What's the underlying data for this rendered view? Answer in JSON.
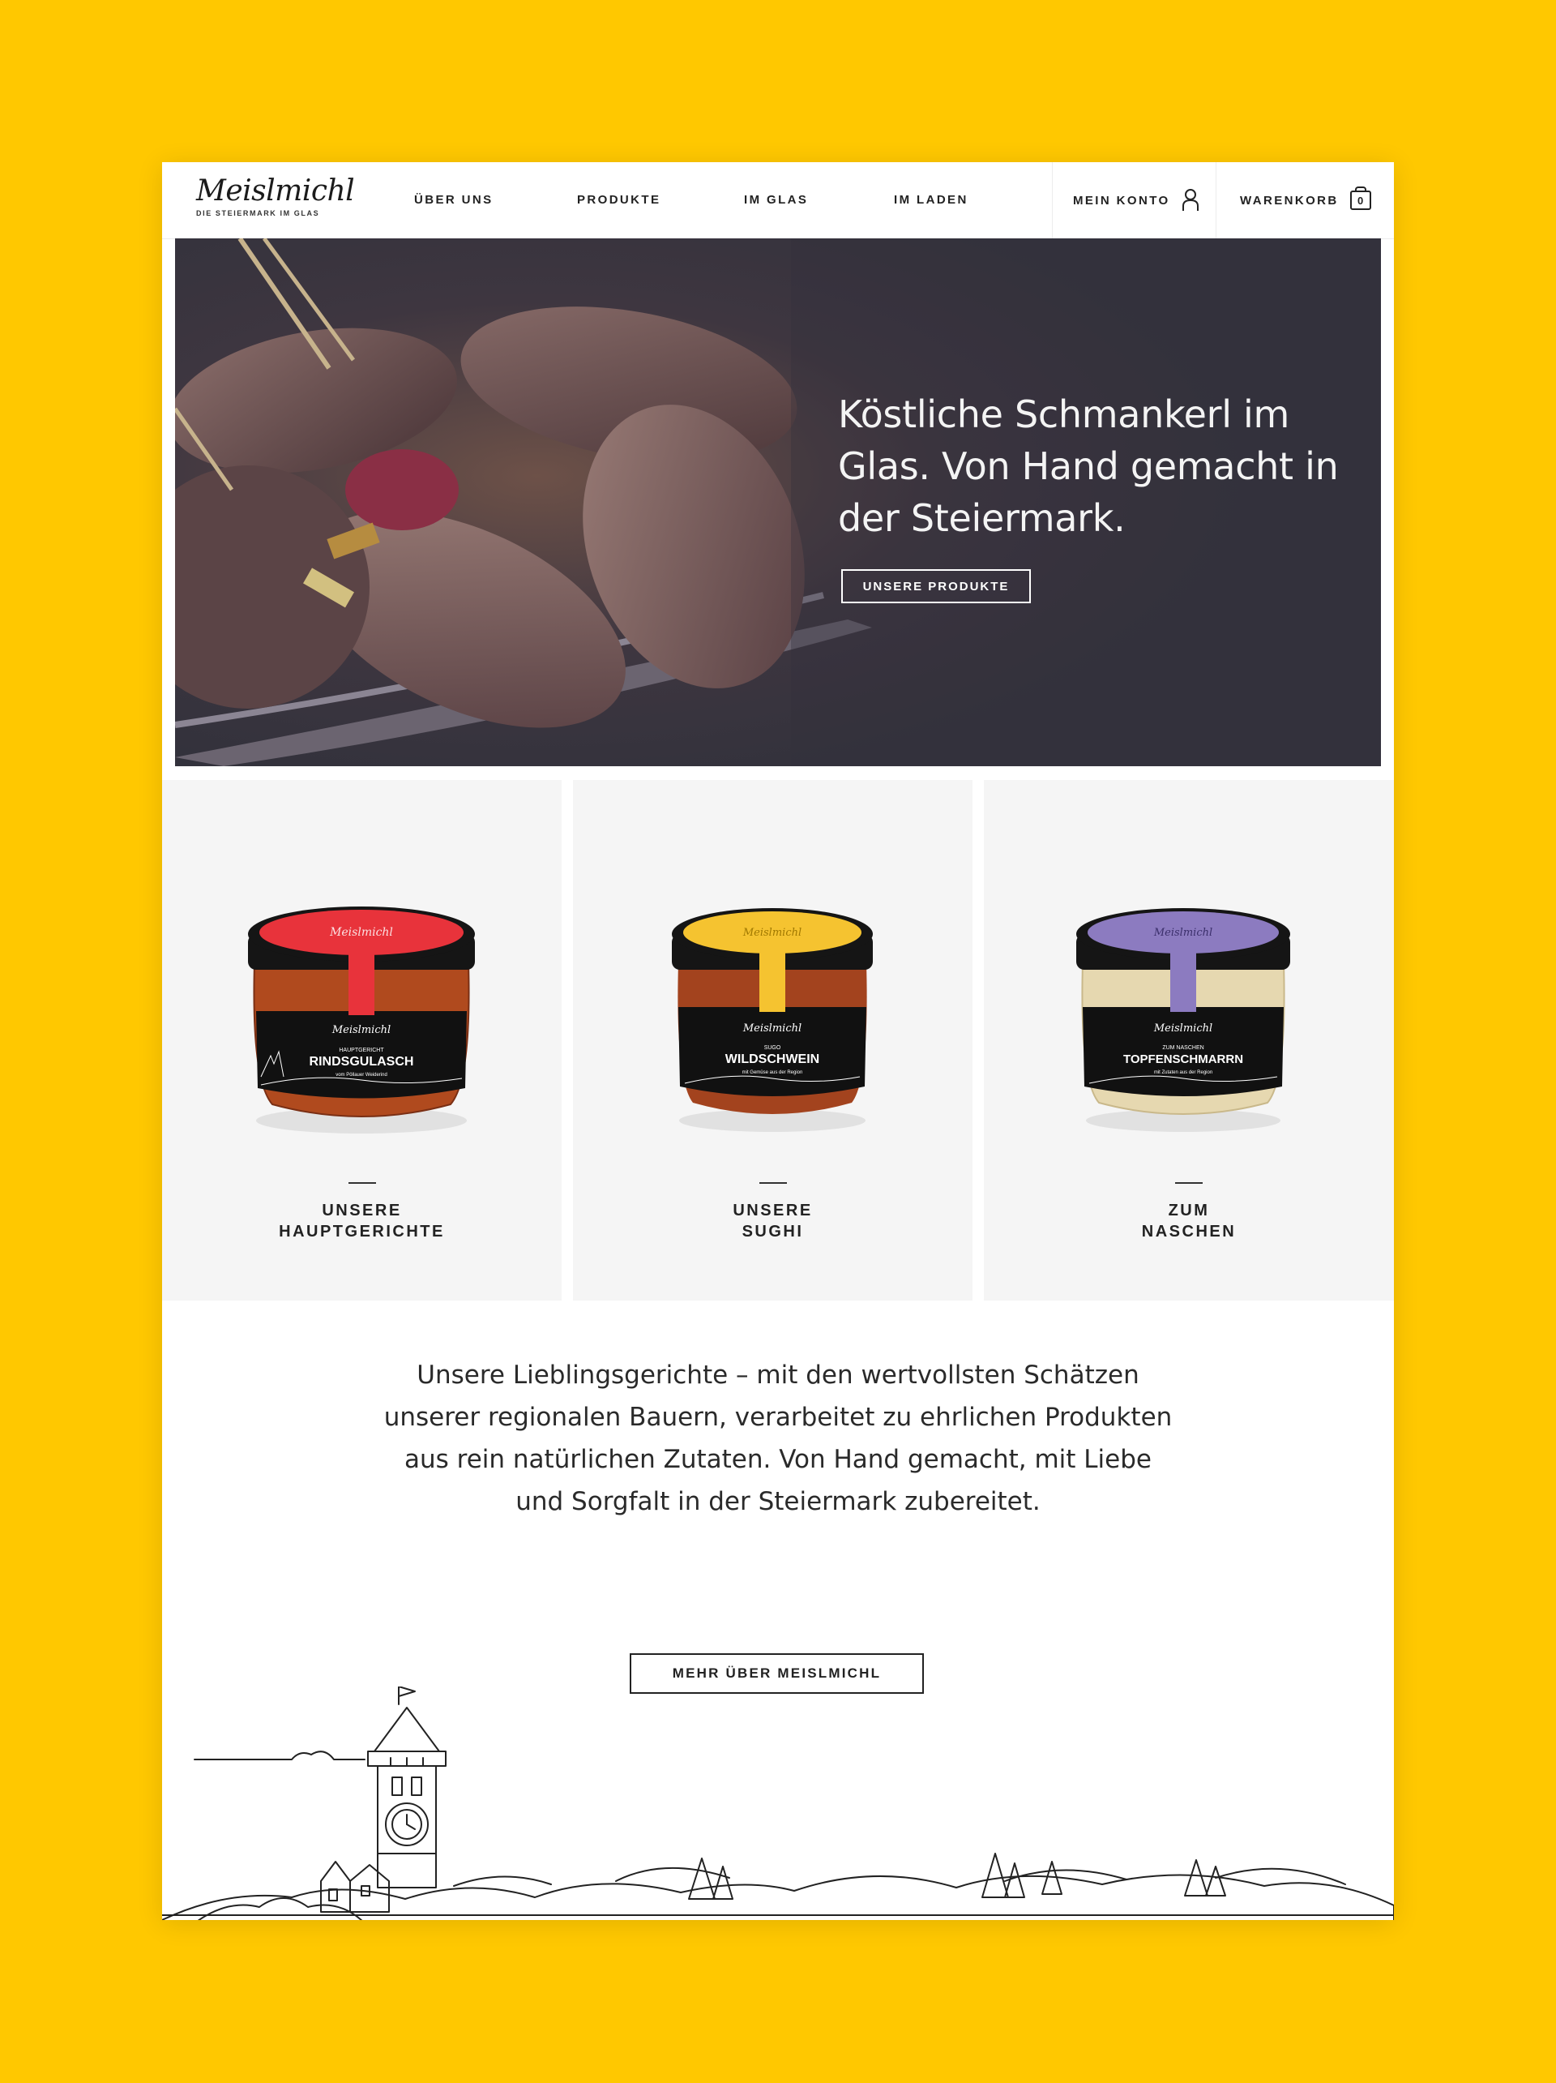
{
  "header": {
    "logo_name": "Meislmichl",
    "logo_tagline": "DIE STEIERMARK IM GLAS",
    "nav": [
      {
        "label": "ÜBER UNS"
      },
      {
        "label": "PRODUKTE"
      },
      {
        "label": "IM GLAS"
      },
      {
        "label": "IM LADEN"
      }
    ],
    "account_label": "MEIN KONTO",
    "account_icon": "user-icon",
    "cart_label": "WARENKORB",
    "cart_count": "0",
    "cart_icon": "cart-icon"
  },
  "hero": {
    "title": "Köstliche Schmankerl im Glas. Von Hand gemacht in der Steiermark.",
    "button_label": "UNSERE PRODUKTE"
  },
  "categories": [
    {
      "label_line1": "UNSERE",
      "label_line2": "HAUPTGERICHTE",
      "jar_brand": "Meislmichl",
      "jar_kicker": "HAUPTGERICHT",
      "jar_name": "RINDSGULASCH",
      "jar_sub": "vom Pöllauer Weiderind",
      "lid_color": "#E8333B",
      "fill_color": "#B04A1E"
    },
    {
      "label_line1": "UNSERE",
      "label_line2": "SUGHI",
      "jar_brand": "Meislmichl",
      "jar_kicker": "SUGO",
      "jar_name": "WILDSCHWEIN",
      "jar_sub": "mit Gemüse aus der Region",
      "lid_color": "#F5C330",
      "fill_color": "#A3431E"
    },
    {
      "label_line1": "ZUM",
      "label_line2": "NASCHEN",
      "jar_brand": "Meislmichl",
      "jar_kicker": "ZUM NASCHEN",
      "jar_name": "TOPFENSCHMARRN",
      "jar_sub": "mit Zutaten aus der Region",
      "lid_color": "#8C7BC0",
      "fill_color": "#E6D8B0"
    }
  ],
  "intro": {
    "line1": "Unsere Lieblingsgerichte – mit den wertvollsten Schätzen",
    "line2": "unserer regionalen Bauern, verarbeitet zu ehrlichen Produkten",
    "line3": "aus rein natürlichen Zutaten. Von Hand gemacht, mit Liebe",
    "line4": "und Sorgfalt in der Steiermark zubereitet.",
    "button_label": "MEHR ÜBER MEISLMICHL"
  },
  "colors": {
    "background": "#FFC800",
    "hero_bg": "#33323c",
    "card_bg": "#f5f5f5"
  }
}
